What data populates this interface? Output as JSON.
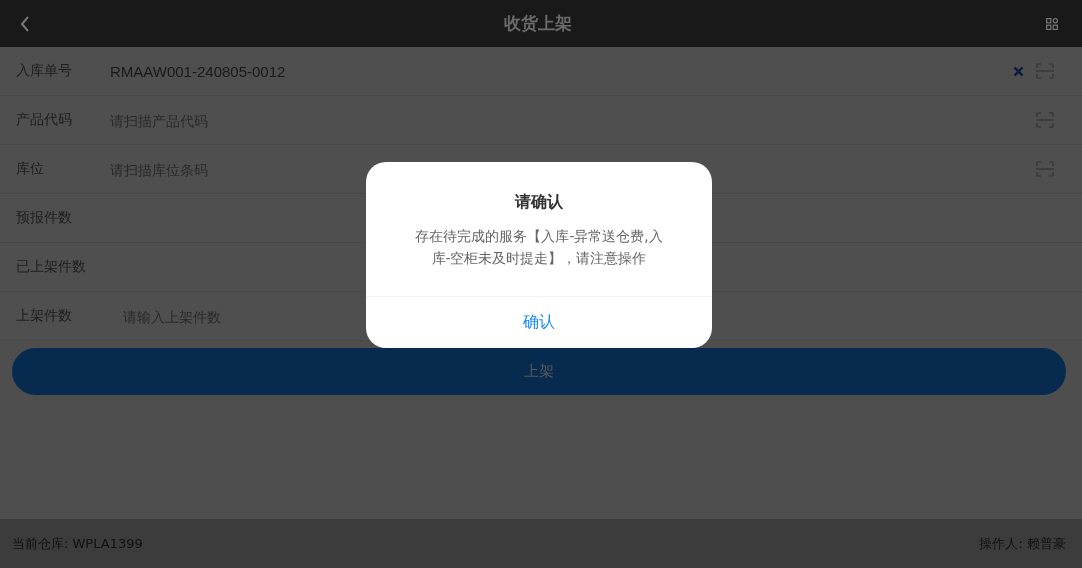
{
  "header": {
    "title": "收货上架"
  },
  "fields": [
    {
      "kind": "scan",
      "label": "入库单号",
      "value": "RMAAW001-240805-0012",
      "clearable": true
    },
    {
      "kind": "scan",
      "label": "产品代码",
      "placeholder": "请扫描产品代码",
      "clearable": false
    },
    {
      "kind": "scan",
      "label": "库位",
      "placeholder": "请扫描库位条码",
      "clearable": false
    },
    {
      "kind": "display",
      "label": "预报件数"
    },
    {
      "kind": "display",
      "label": "已上架件数"
    },
    {
      "kind": "input",
      "label": "上架件数",
      "placeholder": "请输入上架件数"
    }
  ],
  "submit_button": "上架",
  "dialog": {
    "title": "请确认",
    "message": "存在待完成的服务【入库-异常送仓费,入库-空柜未及时提走】，请注意操作",
    "confirm": "确认"
  },
  "footer": {
    "warehouse": "当前仓库: WPLA1399",
    "operator": "操作人: 赖普豪"
  }
}
